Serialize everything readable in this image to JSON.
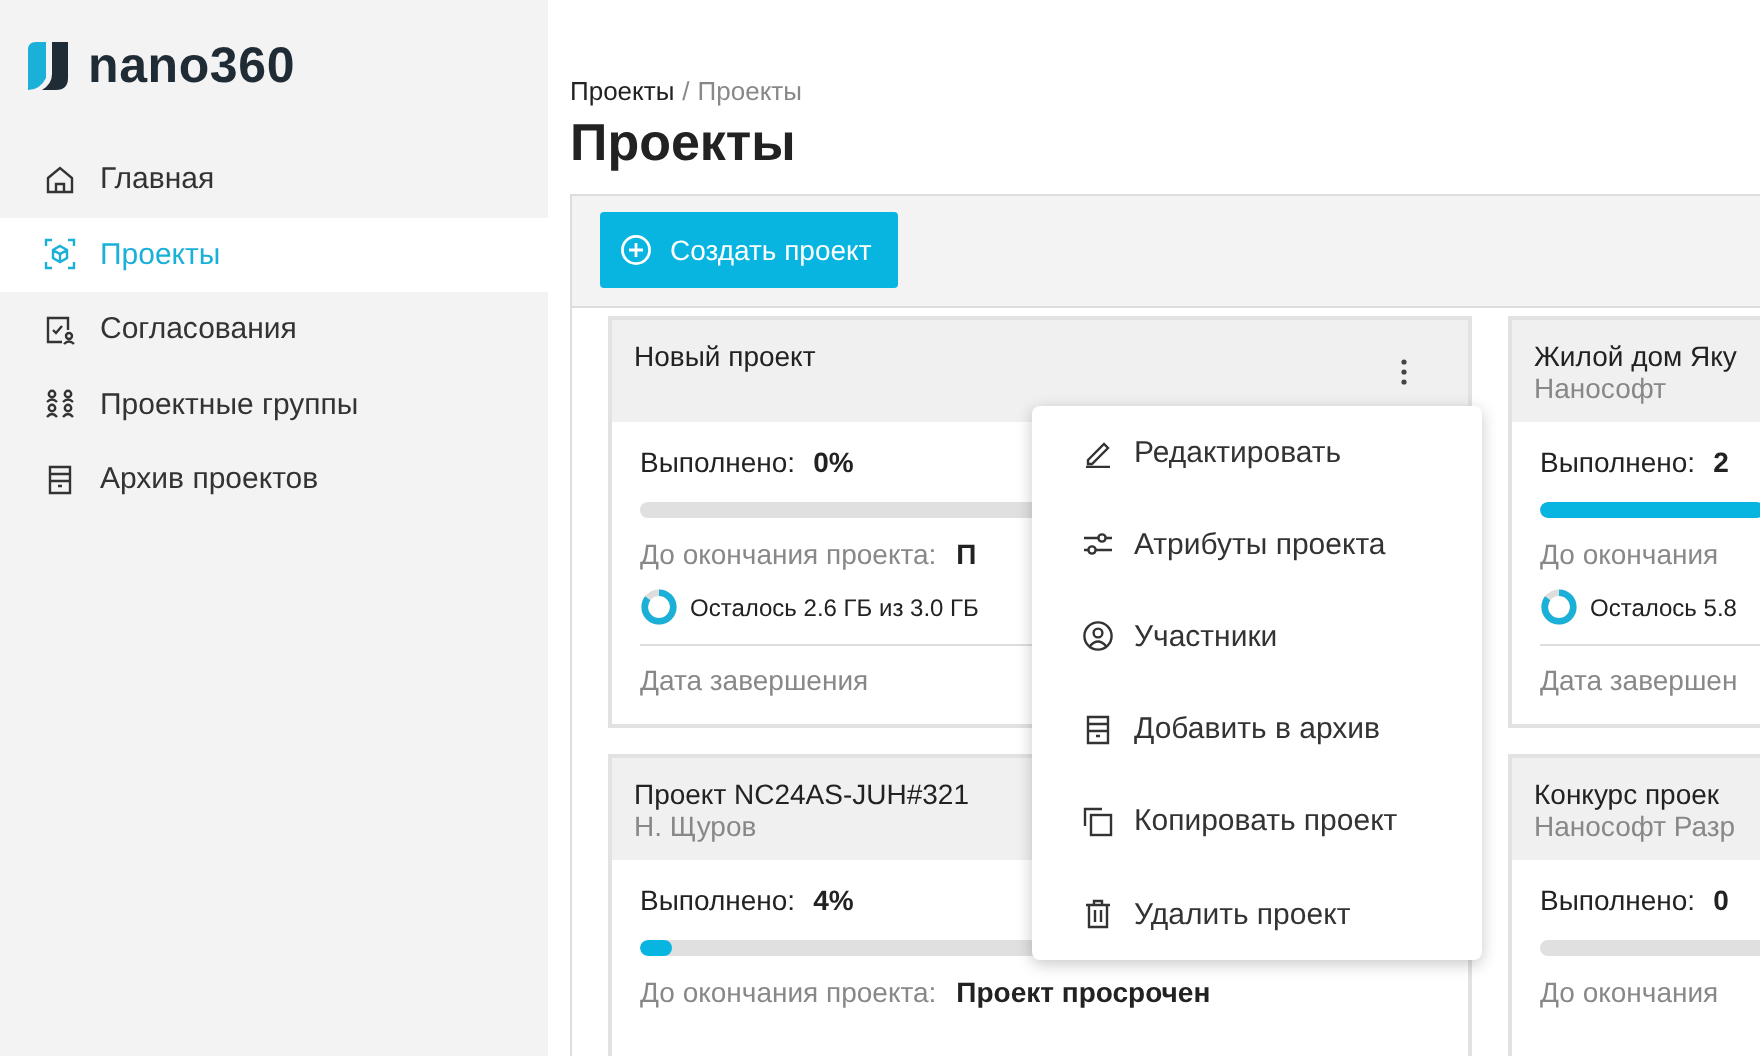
{
  "logo": {
    "text": "nano360"
  },
  "nav": [
    {
      "kind": "home",
      "label": "Главная",
      "selected": false
    },
    {
      "kind": "projects",
      "label": "Проекты",
      "selected": true
    },
    {
      "kind": "approvals",
      "label": "Согласования",
      "selected": false
    },
    {
      "kind": "groups",
      "label": "Проектные группы",
      "selected": false
    },
    {
      "kind": "archive",
      "label": "Архив проектов",
      "selected": false
    }
  ],
  "breadcrumb": {
    "parent": "Проекты",
    "separator": "/",
    "current": "Проекты"
  },
  "page_title": "Проекты",
  "create_button": {
    "label": "Создать проект"
  },
  "cards": [
    {
      "title": "Новый проект",
      "menu_open": true,
      "progress_label": "Выполнено:",
      "progress_value": "0%",
      "level": 0,
      "deadline_label": "До окончания проекта:",
      "deadline_value": "П",
      "storage": "Осталось 2.6 ГБ из 3.0 ГБ",
      "date_label": "Дата завершения"
    },
    {
      "title": "Жилой дом Яку",
      "subtitle": "Нанософт",
      "progress_label": "Выполнено:",
      "progress_value": "2",
      "level": 0.28,
      "deadline_label": "До окончания",
      "storage": "Осталось 5.8",
      "date_label": "Дата завершен"
    },
    {
      "title": "Проект NC24AS-JUH#321",
      "subtitle": "Н. Щуров",
      "progress_label": "Выполнено:",
      "progress_value": "4%",
      "level": 0.04,
      "deadline_label": "До окончания проекта:",
      "deadline_value": "Проект просрочен"
    },
    {
      "title": "Конкурс проек",
      "subtitle": "Нанософт Разр",
      "progress_label": "Выполнено:",
      "progress_value": "0",
      "level": 0,
      "deadline_label": "До окончания"
    }
  ],
  "context_menu": {
    "items": [
      {
        "kind": "edit",
        "label": "Редактировать"
      },
      {
        "kind": "attributes",
        "label": "Атрибуты проекта"
      },
      {
        "kind": "members",
        "label": "Участники"
      },
      {
        "kind": "archive",
        "label": "Добавить в архив"
      },
      {
        "kind": "copy",
        "label": "Копировать проект"
      },
      {
        "kind": "delete",
        "label": "Удалить проект"
      }
    ]
  }
}
